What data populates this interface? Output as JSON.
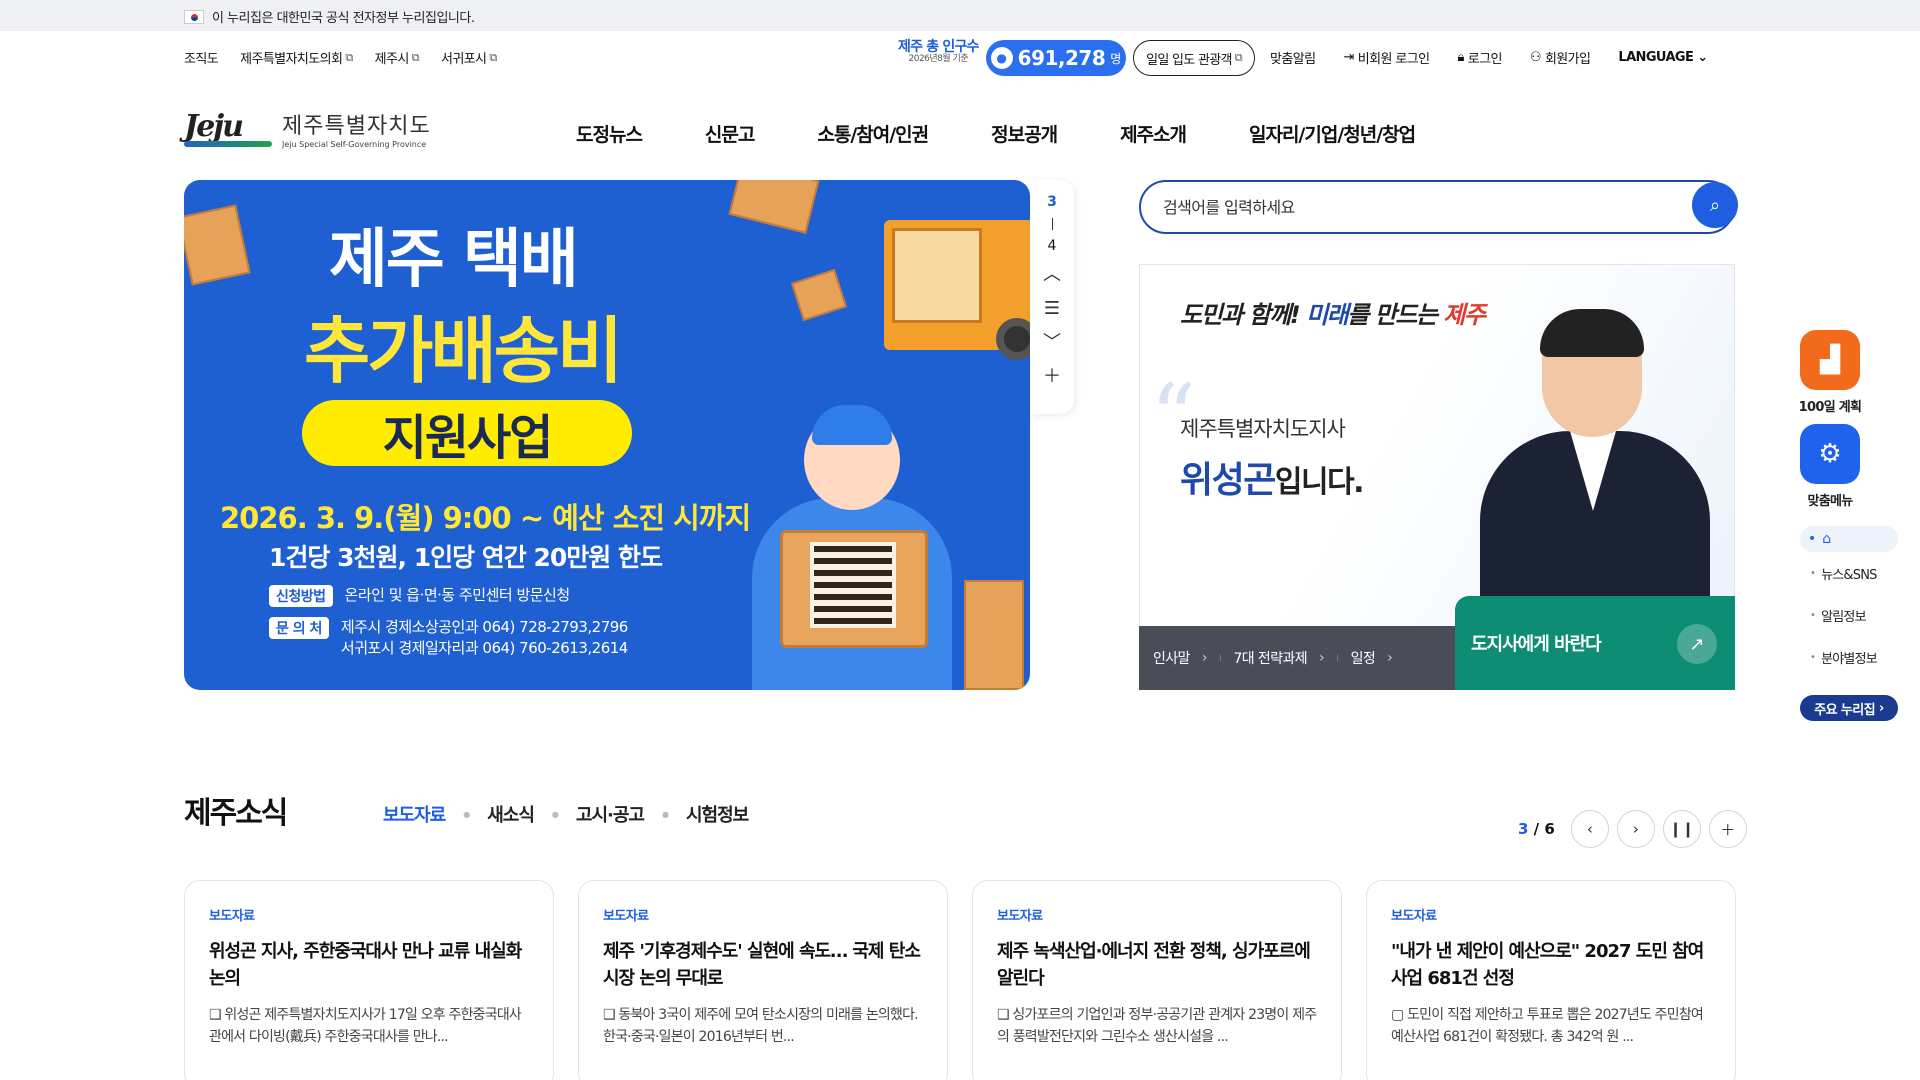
{
  "gov_banner": {
    "text": "이 누리집은 대한민국 공식 전자정부 누리집입니다."
  },
  "util_left": [
    "조직도",
    "제주특별자치도의회",
    "제주시",
    "서귀포시"
  ],
  "population": {
    "label": "제주 총 인구수",
    "basis": "2026년8월 기준",
    "value": "691,278",
    "unit": "명"
  },
  "tour": {
    "label": "일일 입도 관광객"
  },
  "util_right": {
    "alert": "맞춤알림",
    "nonmember": "비회원 로그인",
    "login": "로그인",
    "join": "회원가입",
    "language": "LANGUAGE"
  },
  "logo": {
    "mark": "Jeju",
    "ko": "제주특별자치도",
    "en": "Jeju Special Self-Governing Province"
  },
  "gnb": [
    "도정뉴스",
    "신문고",
    "소통/참여/인권",
    "정보공개",
    "제주소개",
    "일자리/기업/청년/창업"
  ],
  "hero": {
    "title1": "제주 택배",
    "title2": "추가배송비",
    "pill": "지원사업",
    "date": "2026. 3. 9.(월) 9:00 ~ 예산 소진 시까지",
    "limit": "1건당 3천원, 1인당 연간 20만원 한도",
    "apply_tag": "신청방법",
    "apply_val": "온라인 및 읍·면·동 주민센터 방문신청",
    "contact_tag": "문 의 처",
    "contact_val1": "제주시 경제소상공인과 064) 728-2793,2796",
    "contact_val2": "서귀포시 경제일자리과 064) 760-2613,2614",
    "slide_current": "3",
    "slide_total": "4"
  },
  "search": {
    "placeholder": "검색어를 입력하세요"
  },
  "governor": {
    "slogan_1": "도민과 ",
    "slogan_2": "함께!",
    "slogan_3": " 미래",
    "slogan_4": "를 만드는 ",
    "slogan_5": "제주",
    "role": "제주특별자치도지사",
    "name": "위성곤",
    "name_suffix": "입니다.",
    "links": [
      "인사말",
      "7대 전략과제",
      "일정"
    ],
    "wish": "도지사에게 바란다"
  },
  "quick": {
    "plan": "100일 계획",
    "custom": "맞춤메뉴",
    "nav": [
      "뉴스&SNS",
      "알림정보",
      "분야별정보"
    ],
    "major": "주요 누리집"
  },
  "news": {
    "title": "제주소식",
    "tabs": [
      "보도자료",
      "새소식",
      "고시·공고",
      "시험정보"
    ],
    "page_current": "3",
    "page_total": "6",
    "cards": [
      {
        "cat": "보도자료",
        "title": "위성곤 지사, 주한중국대사 만나 교류 내실화 논의",
        "summary": "❑ 위성곤 제주특별자치도지사가 17일 오후 주한중국대사관에서 다이빙(戴兵) 주한중국대사를 만나..."
      },
      {
        "cat": "보도자료",
        "title": "제주 '기후경제수도' 실현에 속도… 국제 탄소시장 논의 무대로",
        "summary": "❑ 동북아 3국이 제주에 모여 탄소시장의 미래를 논의했다. 한국·중국·일본이 2016년부터 번..."
      },
      {
        "cat": "보도자료",
        "title": "제주 녹색산업·에너지 전환 정책, 싱가포르에 알린다",
        "summary": "❑ 싱가포르의 기업인과 정부·공공기관 관계자 23명이 제주의 풍력발전단지와 그린수소 생산시설을 ..."
      },
      {
        "cat": "보도자료",
        "title": "\"내가 낸 제안이 예산으로\" 2027 도민 참여사업 681건 선정",
        "summary": "▢ 도민이 직접 제안하고 투표로 뽑은 2027년도 주민참여예산사업 681건이 확정됐다. 총 342억 원 ..."
      }
    ]
  },
  "colors": {
    "primary": "#1f5ee0",
    "navy": "#1a3b8f",
    "orange": "#f26a1b",
    "green": "#0d8d73"
  }
}
